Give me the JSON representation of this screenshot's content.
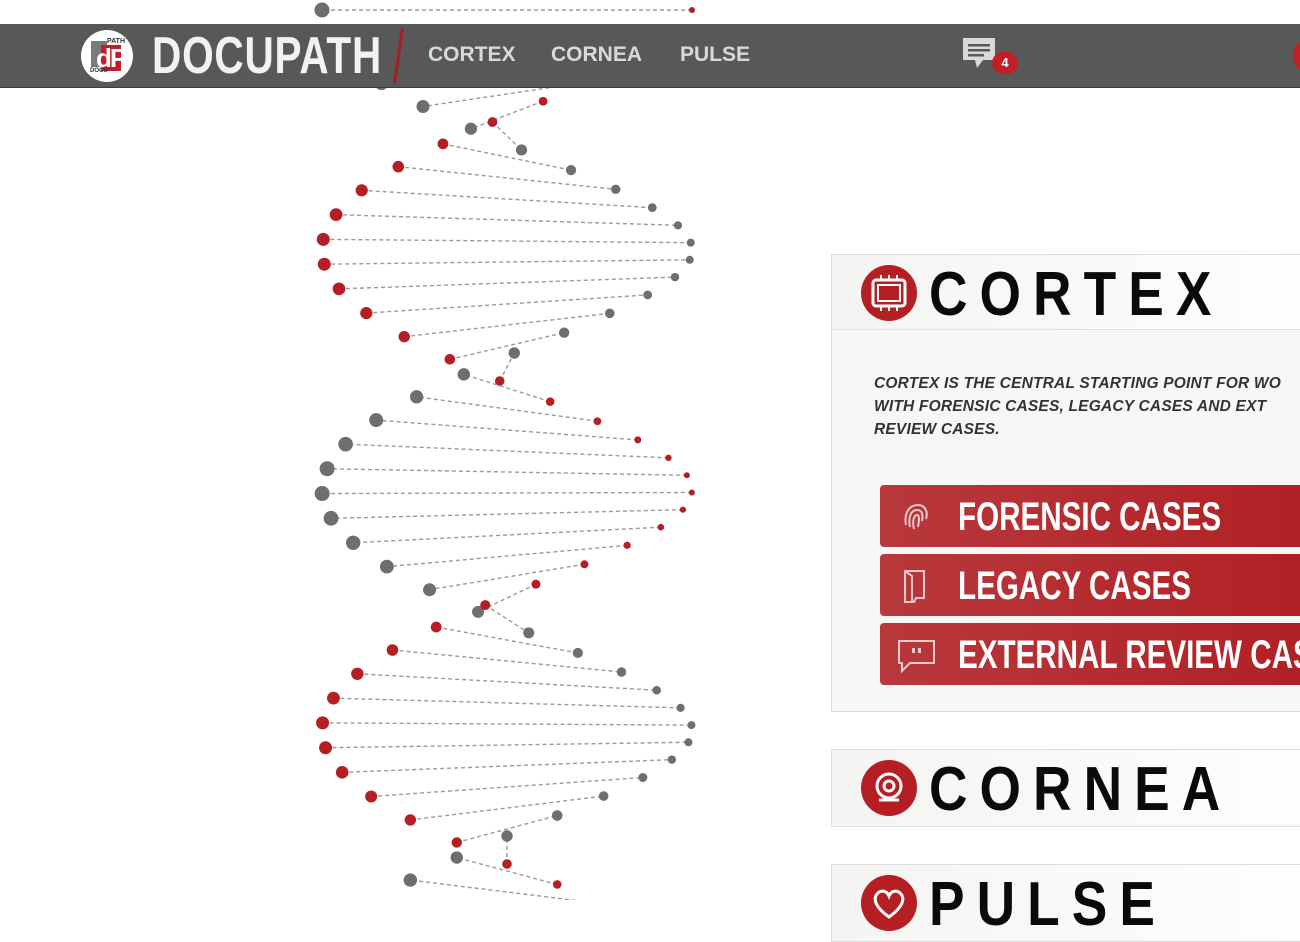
{
  "app": {
    "brand": "DOCUPATH",
    "logo_text_top": "PATH",
    "logo_text_bottom": "DOCU",
    "logo_letters": "dP"
  },
  "nav": {
    "links": [
      "CORTEX",
      "CORNEA",
      "PULSE"
    ],
    "messages_icon": "chat-icon",
    "messages_count": "4"
  },
  "colors": {
    "accent": "#c21e25",
    "navbar": "#585858",
    "helix_red": "#b51f24",
    "helix_gray": "#6e6e6e"
  },
  "cards": {
    "cortex": {
      "title": "CORTEX",
      "icon": "chip-icon",
      "description_lines": [
        "CORTEX IS THE CENTRAL STARTING POINT FOR WO",
        "WITH FORENSIC CASES, LEGACY CASES AND EXT",
        "REVIEW CASES."
      ],
      "buttons": [
        {
          "label": "FORENSIC CASES",
          "icon": "fingerprint-icon"
        },
        {
          "label": "LEGACY CASES",
          "icon": "folder-icon"
        },
        {
          "label": "EXTERNAL REVIEW CASES",
          "icon": "speech-bubble-icon"
        }
      ]
    },
    "cornea": {
      "title": "CORNEA",
      "icon": "eye-icon"
    },
    "pulse": {
      "title": "PULSE",
      "icon": "heart-icon"
    }
  }
}
